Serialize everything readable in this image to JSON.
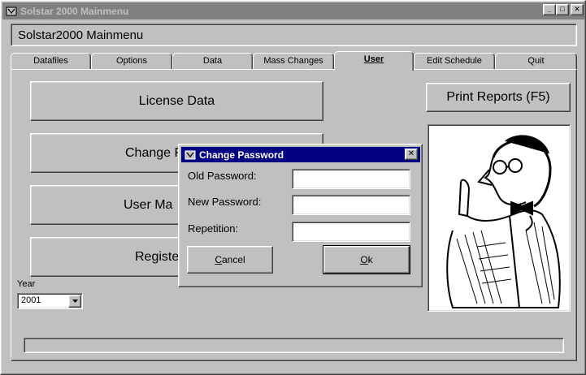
{
  "window": {
    "title": "Solstar 2000 Mainmenu",
    "controls": {
      "minimize": "_",
      "maximize": "□",
      "close": "✕"
    }
  },
  "header": {
    "title": "Solstar2000 Mainmenu"
  },
  "tabs": [
    {
      "label": "Datafiles",
      "active": false
    },
    {
      "label": "Options",
      "active": false
    },
    {
      "label": "Data",
      "active": false
    },
    {
      "label": "Mass Changes",
      "active": false
    },
    {
      "label": "User",
      "active": true
    },
    {
      "label": "Edit Schedule",
      "active": false
    },
    {
      "label": "Quit",
      "active": false
    }
  ],
  "user_panel": {
    "buttons": {
      "license_data": "License Data",
      "change_password_visible": "Change P",
      "user_management_visible": "User Ma",
      "user_management_mnemonic": "n",
      "register_visible": "Registe"
    },
    "print_reports": "Print Reports (F5)",
    "year": {
      "label": "Year",
      "selected": "2001"
    }
  },
  "dialog": {
    "title": "Change Password",
    "old_password_label": "Old Password:",
    "old_password_value": "",
    "new_password_label": "New Password:",
    "new_password_value": "",
    "repetition_label": "Repetition:",
    "repetition_value": "",
    "cancel_mnemonic": "C",
    "cancel_rest": "ancel",
    "ok_mnemonic": "O",
    "ok_rest": "k",
    "close": "✕"
  },
  "colors": {
    "face": "#c0c0c0",
    "inactive_title": "#808080",
    "active_title": "#000080"
  }
}
